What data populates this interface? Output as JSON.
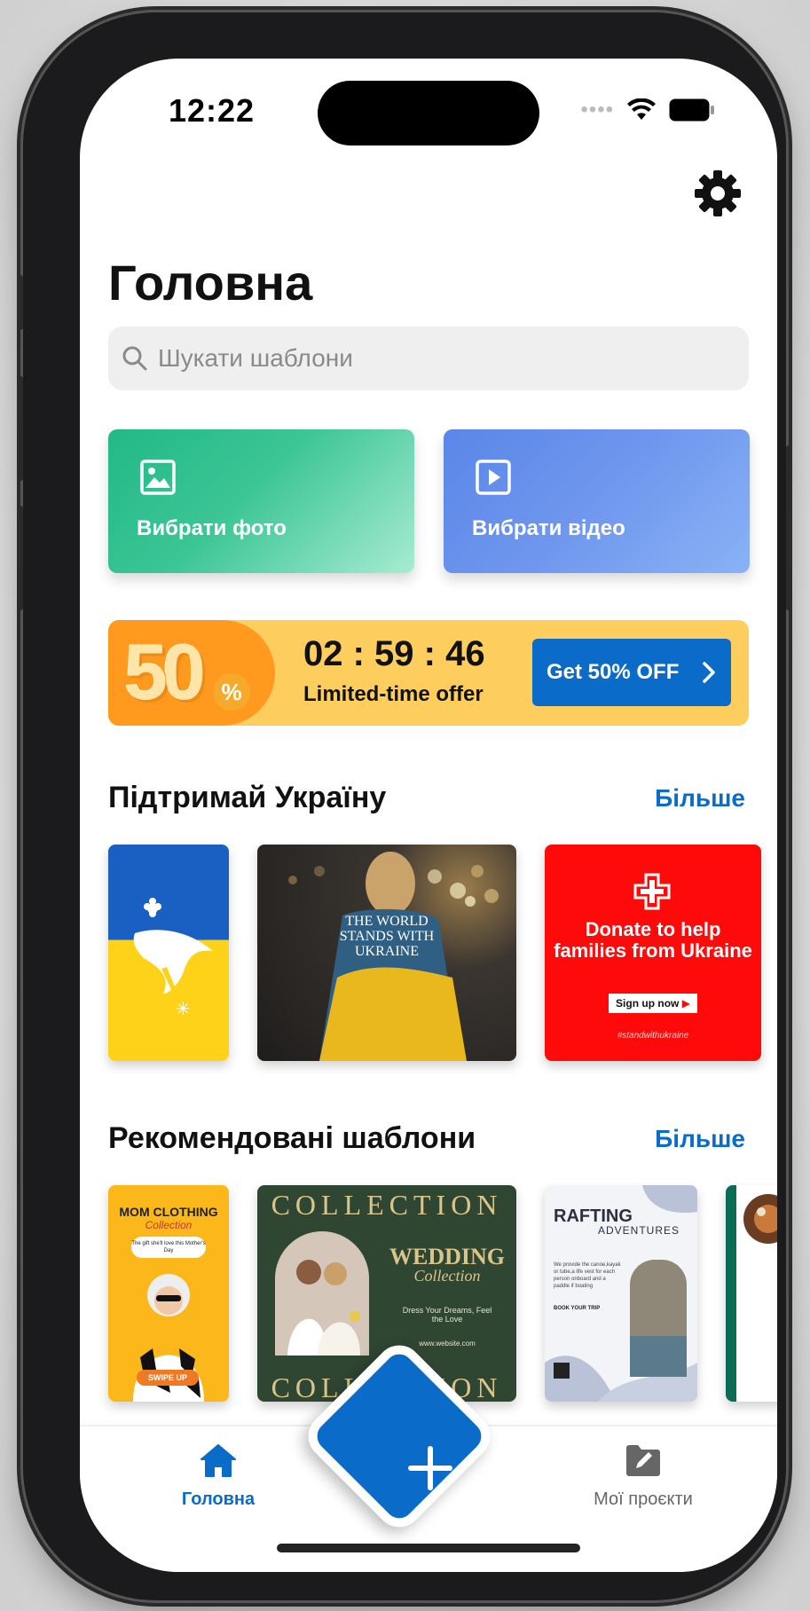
{
  "status_bar": {
    "time": "12:22"
  },
  "header": {
    "title": "Головна"
  },
  "search": {
    "placeholder": "Шукати шаблони"
  },
  "actions": {
    "photo_label": "Вибрати фото",
    "video_label": "Вибрати відео"
  },
  "promo": {
    "badge_number": "50",
    "badge_percent": "%",
    "timer": "02 : 59 : 46",
    "offer_text": "Limited-time offer",
    "button_label": "Get 50% OFF"
  },
  "sections": {
    "ukraine": {
      "title": "Підтримай Україну",
      "more": "Більше"
    },
    "recommended": {
      "title": "Рекомендовані шаблони",
      "more": "Більше"
    }
  },
  "ukraine_templates": {
    "world_text": "THE WORLD STANDS WITH UKRAINE",
    "donate_text": "Donate to help families from Ukraine",
    "signup": "Sign up now",
    "hashtag": "#standwithukraine"
  },
  "recommended_templates": {
    "mom_title": "MOM CLOTHING",
    "mom_sub": "Collection",
    "mom_note": "The gift she'll love this Mother's Day",
    "mom_swipe": "SWIPE UP",
    "wedding_top": "COLLECTION",
    "wedding_title": "WEDDING",
    "wedding_sub": "Collection",
    "wedding_tag": "Dress Your Dreams, Feel the Love",
    "wedding_url": "www.website.com",
    "wedding_bottom": "COLLECTION",
    "rafting_title": "RAFTING",
    "rafting_sub": "ADVENTURES",
    "rafting_body": "We provide the canoe,kayak or tube,a life vest for each person onboard and a paddle if boating",
    "rafting_book": "BOOK YOUR TRIP"
  },
  "tabbar": {
    "home_label": "Головна",
    "projects_label": "Мої проєкти"
  },
  "colors": {
    "accent": "#0a6cc8",
    "photo_card": "#22b987",
    "video_card": "#5b86e8",
    "promo_bg": "#fdcd5e"
  }
}
